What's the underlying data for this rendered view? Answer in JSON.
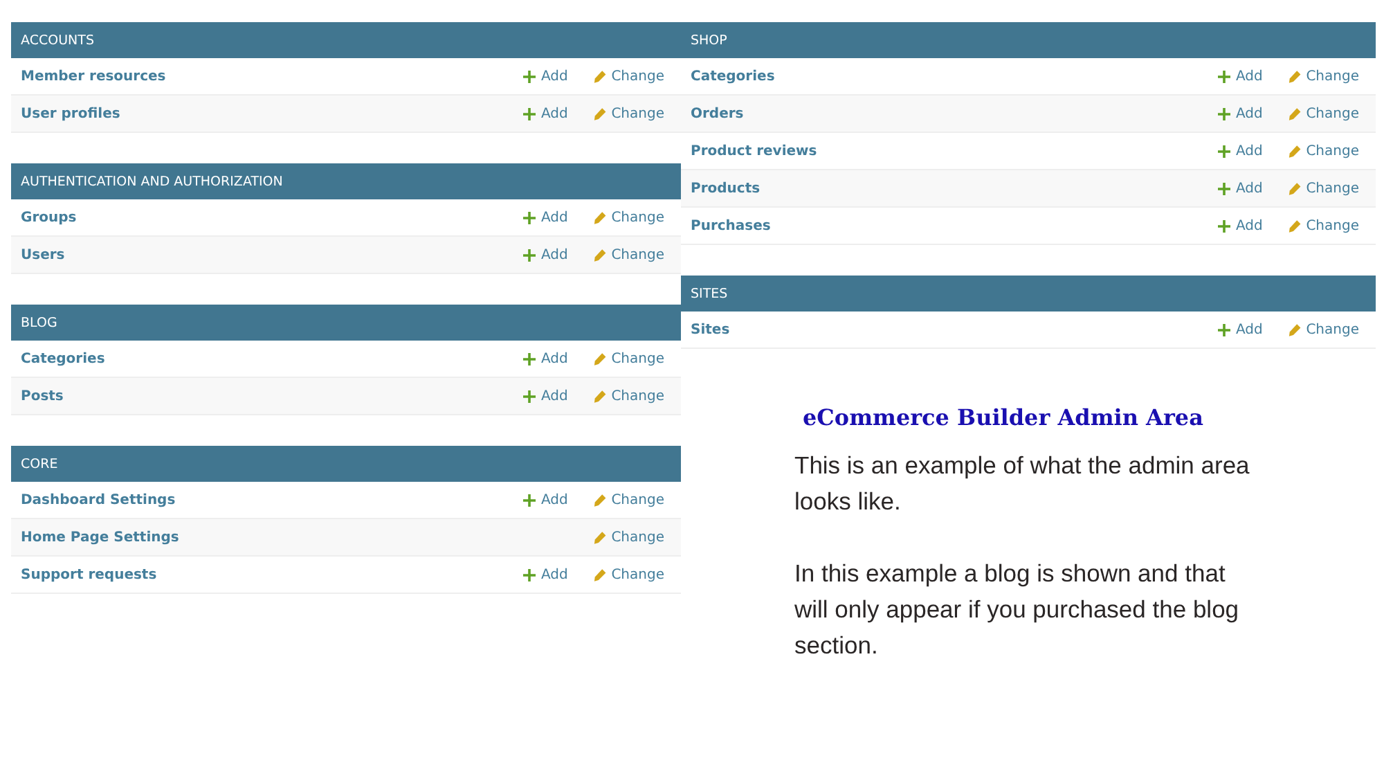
{
  "columns": [
    {
      "modules": [
        {
          "title": "ACCOUNTS",
          "rows": [
            {
              "name": "Member resources",
              "add": "Add",
              "change": "Change"
            },
            {
              "name": "User profiles",
              "add": "Add",
              "change": "Change"
            }
          ]
        },
        {
          "title": "AUTHENTICATION AND AUTHORIZATION",
          "rows": [
            {
              "name": "Groups",
              "add": "Add",
              "change": "Change"
            },
            {
              "name": "Users",
              "add": "Add",
              "change": "Change"
            }
          ]
        },
        {
          "title": "BLOG",
          "rows": [
            {
              "name": "Categories",
              "add": "Add",
              "change": "Change"
            },
            {
              "name": "Posts",
              "add": "Add",
              "change": "Change"
            }
          ]
        },
        {
          "title": "CORE",
          "rows": [
            {
              "name": "Dashboard Settings",
              "add": "Add",
              "change": "Change"
            },
            {
              "name": "Home Page Settings",
              "change": "Change"
            },
            {
              "name": "Support requests",
              "add": "Add",
              "change": "Change"
            }
          ]
        }
      ]
    },
    {
      "modules": [
        {
          "title": "SHOP",
          "rows": [
            {
              "name": "Categories",
              "add": "Add",
              "change": "Change"
            },
            {
              "name": "Orders",
              "add": "Add",
              "change": "Change"
            },
            {
              "name": "Product reviews",
              "add": "Add",
              "change": "Change"
            },
            {
              "name": "Products",
              "add": "Add",
              "change": "Change"
            },
            {
              "name": "Purchases",
              "add": "Add",
              "change": "Change"
            }
          ]
        },
        {
          "title": "SITES",
          "rows": [
            {
              "name": "Sites",
              "add": "Add",
              "change": "Change"
            }
          ]
        }
      ]
    }
  ],
  "note": {
    "heading": "eCommerce Builder Admin Area",
    "paragraphs": [
      "This is an example of what the admin area looks like.",
      "In this example a blog is shown and that will only appear if you purchased the blog section."
    ]
  }
}
